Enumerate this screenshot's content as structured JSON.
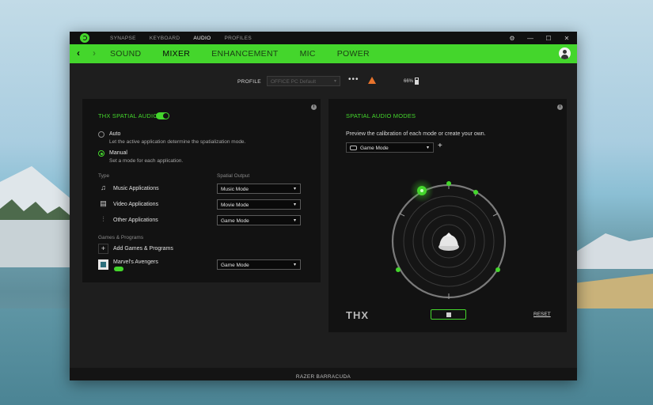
{
  "app": {
    "top_nav": [
      "SYNAPSE",
      "KEYBOARD",
      "AUDIO",
      "PROFILES"
    ],
    "top_nav_active": "AUDIO",
    "window_controls": [
      "settings-icon",
      "minimize-icon",
      "maximize-icon",
      "close-icon"
    ]
  },
  "subnav": {
    "tabs": [
      "SOUND",
      "MIXER",
      "ENHANCEMENT",
      "MIC",
      "POWER"
    ],
    "active": "MIXER",
    "accent": "#44d62c"
  },
  "profile": {
    "label": "PROFILE",
    "value": "OFFICE PC Default",
    "more": "•••",
    "battery": "66%"
  },
  "thx": {
    "title": "THX SPATIAL AUDIO",
    "enabled": true,
    "options": [
      {
        "title": "Auto",
        "desc": "Let the active application determine the spatialization mode.",
        "selected": false
      },
      {
        "title": "Manual",
        "desc": "Set a mode for each application.",
        "selected": true
      }
    ],
    "col_type": "Type",
    "col_output": "Spatial Output",
    "rows": [
      {
        "icon": "music-icon",
        "label": "Music Applications",
        "output": "Music Mode"
      },
      {
        "icon": "film-icon",
        "label": "Video Applications",
        "output": "Movie Mode"
      },
      {
        "icon": "sliders-icon",
        "label": "Other Applications",
        "output": "Game Mode"
      }
    ],
    "games_header": "Games & Programs",
    "add_label": "Add Games & Programs",
    "game": {
      "label": "Marvel's Avengers",
      "output": "Game Mode"
    }
  },
  "spatial": {
    "title": "SPATIAL AUDIO MODES",
    "desc": "Preview the calibration of each mode or create your own.",
    "mode": "Game Mode",
    "add": "+",
    "logo": "THX",
    "reset": "RESET"
  },
  "status": {
    "device": "RAZER BARRACUDA"
  }
}
